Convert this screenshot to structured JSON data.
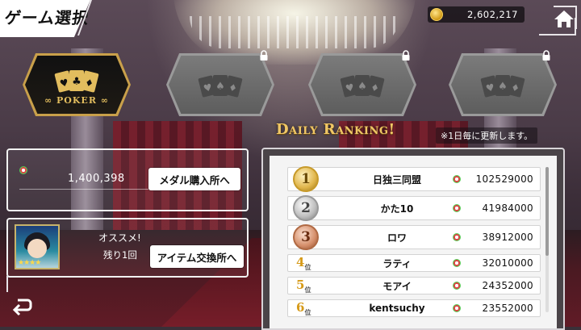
{
  "header": {
    "title": "ゲーム選択",
    "coins": "2,602,217"
  },
  "games": [
    {
      "name": "POKER",
      "state": "selected"
    },
    {
      "name": "",
      "state": "locked"
    },
    {
      "name": "",
      "state": "locked"
    },
    {
      "name": "",
      "state": "locked"
    }
  ],
  "medal_panel": {
    "amount": "1,400,398",
    "button_label": "メダル購入所へ"
  },
  "item_panel": {
    "recommend_label": "オススメ!",
    "remaining_label": "残り1回",
    "stars": "★★★★",
    "button_label": "アイテム交換所へ"
  },
  "ranking": {
    "title": "Daily Ranking!",
    "note": "※1日毎に更新します。",
    "rows": [
      {
        "rank": "1",
        "name": "日独三同盟",
        "score": "102529000"
      },
      {
        "rank": "2",
        "name": "かた10",
        "score": "41984000"
      },
      {
        "rank": "3",
        "name": "ロワ",
        "score": "38912000"
      },
      {
        "rank": "4",
        "suffix": "位",
        "name": "ラティ",
        "score": "32010000"
      },
      {
        "rank": "5",
        "suffix": "位",
        "name": "モアイ",
        "score": "24352000"
      },
      {
        "rank": "6",
        "suffix": "位",
        "name": "kentsuchy",
        "score": "23552000"
      }
    ]
  },
  "colors": {
    "gold": "#e2bd5e",
    "accent_frame": "#c9a04a",
    "panel_border": "#f2f2f2"
  },
  "icons": [
    "coin-icon",
    "home-icon",
    "cards-icon",
    "lock-icon",
    "chip-icon",
    "back-arrow-icon"
  ]
}
